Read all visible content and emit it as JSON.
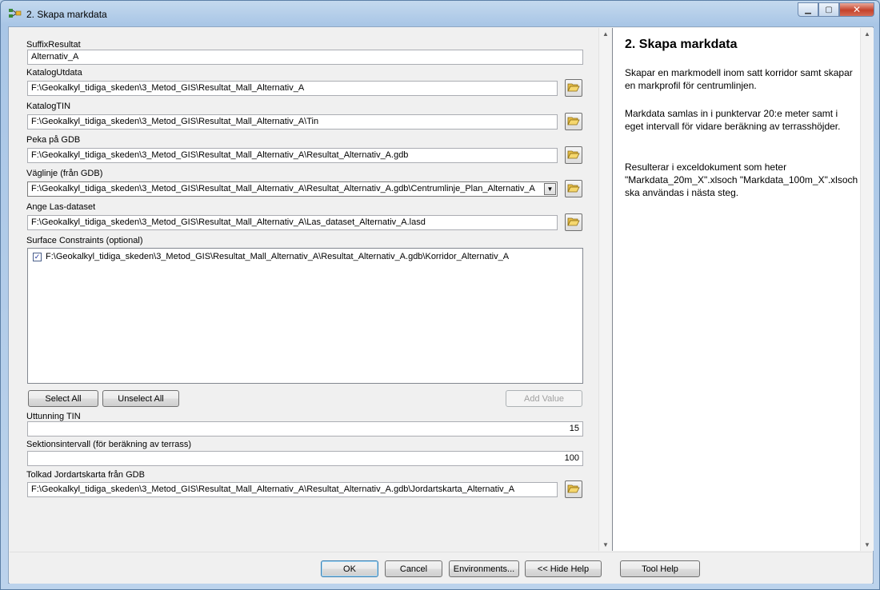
{
  "window": {
    "title": "2. Skapa markdata"
  },
  "params": {
    "suffix_label": "SuffixResultat",
    "suffix_value": "Alternativ_A",
    "katalog_utdata_label": "KatalogUtdata",
    "katalog_utdata_value": "F:\\Geokalkyl_tidiga_skeden\\3_Metod_GIS\\Resultat_Mall_Alternativ_A",
    "katalog_tin_label": "KatalogTIN",
    "katalog_tin_value": "F:\\Geokalkyl_tidiga_skeden\\3_Metod_GIS\\Resultat_Mall_Alternativ_A\\Tin",
    "peka_gdb_label": "Peka på GDB",
    "peka_gdb_value": "F:\\Geokalkyl_tidiga_skeden\\3_Metod_GIS\\Resultat_Mall_Alternativ_A\\Resultat_Alternativ_A.gdb",
    "veglinje_label": "Väglinje (från GDB)",
    "veglinje_value": "F:\\Geokalkyl_tidiga_skeden\\3_Metod_GIS\\Resultat_Mall_Alternativ_A\\Resultat_Alternativ_A.gdb\\Centrumlinje_Plan_Alternativ_A",
    "las_label": "Ange Las-dataset",
    "las_value": "F:\\Geokalkyl_tidiga_skeden\\3_Metod_GIS\\Resultat_Mall_Alternativ_A\\Las_dataset_Alternativ_A.lasd",
    "constraints_label": "Surface Constraints (optional)",
    "constraints_items": [
      {
        "checked": true,
        "text": "F:\\Geokalkyl_tidiga_skeden\\3_Metod_GIS\\Resultat_Mall_Alternativ_A\\Resultat_Alternativ_A.gdb\\Korridor_Alternativ_A"
      }
    ],
    "select_all": "Select All",
    "unselect_all": "Unselect All",
    "add_value": "Add Value",
    "uttunning_label": "Uttunning TIN",
    "uttunning_value": "15",
    "sektion_label": "Sektionsintervall (för beräkning av terrass)",
    "sektion_value": "100",
    "jordart_label": "Tolkad Jordartskarta från GDB",
    "jordart_value": "F:\\Geokalkyl_tidiga_skeden\\3_Metod_GIS\\Resultat_Mall_Alternativ_A\\Resultat_Alternativ_A.gdb\\Jordartskarta_Alternativ_A"
  },
  "help": {
    "title": "2. Skapa markdata",
    "p1": "Skapar en markmodell inom satt korridor samt skapar en markprofil för centrumlinjen.",
    "p2": "Markdata samlas in i punktervar 20:e meter samt i eget intervall för vidare beräkning av terrasshöjder.",
    "p3": "Resulterar i exceldokument som heter \"Markdata_20m_X\".xlsoch \"Markdata_100m_X\".xlsoch ska användas i nästa steg."
  },
  "buttons": {
    "ok": "OK",
    "cancel": "Cancel",
    "environments": "Environments...",
    "hide_help": "<< Hide Help",
    "tool_help": "Tool Help"
  },
  "icons": {
    "app": "model-tool-icon",
    "browse": "folder-open-icon",
    "minimize": "minimize-icon",
    "maximize": "maximize-icon",
    "close": "close-icon"
  }
}
